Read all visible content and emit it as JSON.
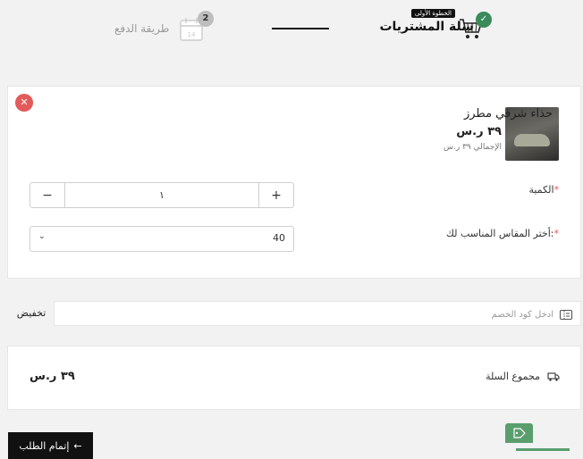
{
  "stepper": {
    "step1": {
      "label": "سلة المشتريات",
      "tag": "الخطوة الأولى",
      "status": "done"
    },
    "step2": {
      "label": "طريقة الدفع",
      "number": "2"
    }
  },
  "product": {
    "name": "حذاء شرقي مطرز",
    "price": "٣٩ ر.س",
    "total": "الإجمالي ٣٩ ر.س",
    "quantity_label": "الكمية",
    "quantity": "١",
    "size_label": "أختر المقاس المناسب لك:",
    "size_value": "40"
  },
  "coupon": {
    "placeholder": "ادخل كود الخصم",
    "button": "تخفيض"
  },
  "summary": {
    "label": "مجموع السلة",
    "value": "٣٩ ر.س"
  },
  "checkout": {
    "label": "إتمام الطلب"
  },
  "colors": {
    "accent": "#3a8a5b",
    "danger": "#e35a5a",
    "dark": "#111111"
  }
}
